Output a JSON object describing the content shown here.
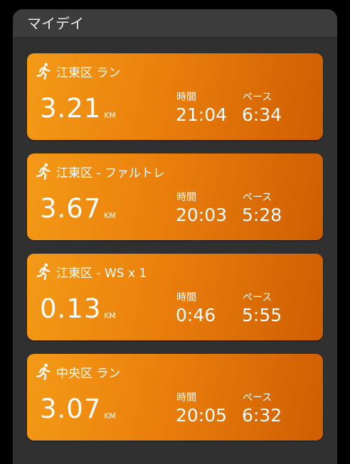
{
  "header": {
    "title": "マイデイ"
  },
  "cards": [
    {
      "title": "江東区 ラン",
      "distance": "3.21",
      "unit": "KM",
      "time_label": "時間",
      "time": "21:04",
      "pace_label": "ペース",
      "pace": "6:34",
      "icon": "runner-icon"
    },
    {
      "title": "江東区 - ファルトレ",
      "distance": "3.67",
      "unit": "KM",
      "time_label": "時間",
      "time": "20:03",
      "pace_label": "ペース",
      "pace": "5:28",
      "icon": "runner-icon"
    },
    {
      "title": "江東区 - WS x 1",
      "distance": "0.13",
      "unit": "KM",
      "time_label": "時間",
      "time": "0:46",
      "pace_label": "ペース",
      "pace": "5:55",
      "icon": "runner-icon"
    },
    {
      "title": "中央区 ラン",
      "distance": "3.07",
      "unit": "KM",
      "time_label": "時間",
      "time": "20:05",
      "pace_label": "ペース",
      "pace": "6:32",
      "icon": "runner-icon"
    }
  ],
  "colors": {
    "card_gradient_start": "#f49a17",
    "card_gradient_end": "#cf5e02",
    "panel_background": "#303030"
  }
}
